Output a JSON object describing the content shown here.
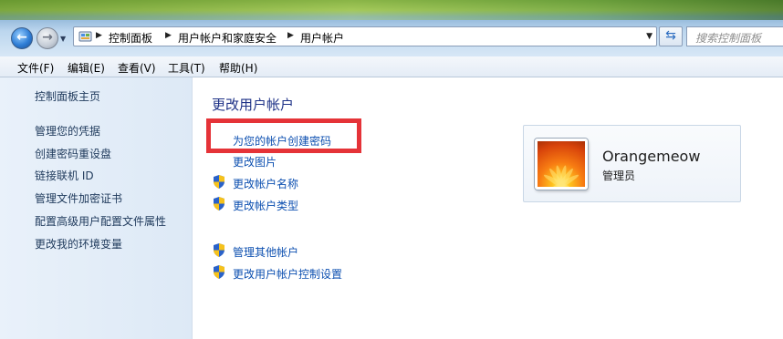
{
  "address_bar": {
    "breadcrumbs": [
      "控制面板",
      "用户帐户和家庭安全",
      "用户帐户"
    ]
  },
  "search": {
    "placeholder": "搜索控制面板"
  },
  "menu": [
    "文件(F)",
    "编辑(E)",
    "查看(V)",
    "工具(T)",
    "帮助(H)"
  ],
  "sidebar": {
    "items": [
      {
        "label": "控制面板主页"
      },
      {
        "label": "管理您的凭据"
      },
      {
        "label": "创建密码重设盘"
      },
      {
        "label": "链接联机 ID"
      },
      {
        "label": "管理文件加密证书"
      },
      {
        "label": "配置高级用户配置文件属性"
      },
      {
        "label": "更改我的环境变量"
      }
    ]
  },
  "main": {
    "title": "更改用户帐户",
    "tasks": [
      {
        "label": "为您的帐户创建密码",
        "shield": false
      },
      {
        "label": "更改图片",
        "shield": false
      },
      {
        "label": "更改帐户名称",
        "shield": true
      },
      {
        "label": "更改帐户类型",
        "shield": true
      }
    ],
    "other_tasks": [
      {
        "label": "管理其他帐户",
        "shield": true
      },
      {
        "label": "更改用户帐户控制设置",
        "shield": true
      }
    ]
  },
  "user": {
    "name": "Orangemeow",
    "role": "管理员"
  },
  "colors": {
    "highlight": "#e53338",
    "link": "#0c4fb0",
    "title": "#1e3287"
  },
  "icons": [
    "back-arrow-icon",
    "forward-arrow-icon",
    "control-panel-icon",
    "refresh-icon",
    "uac-shield-icon"
  ]
}
